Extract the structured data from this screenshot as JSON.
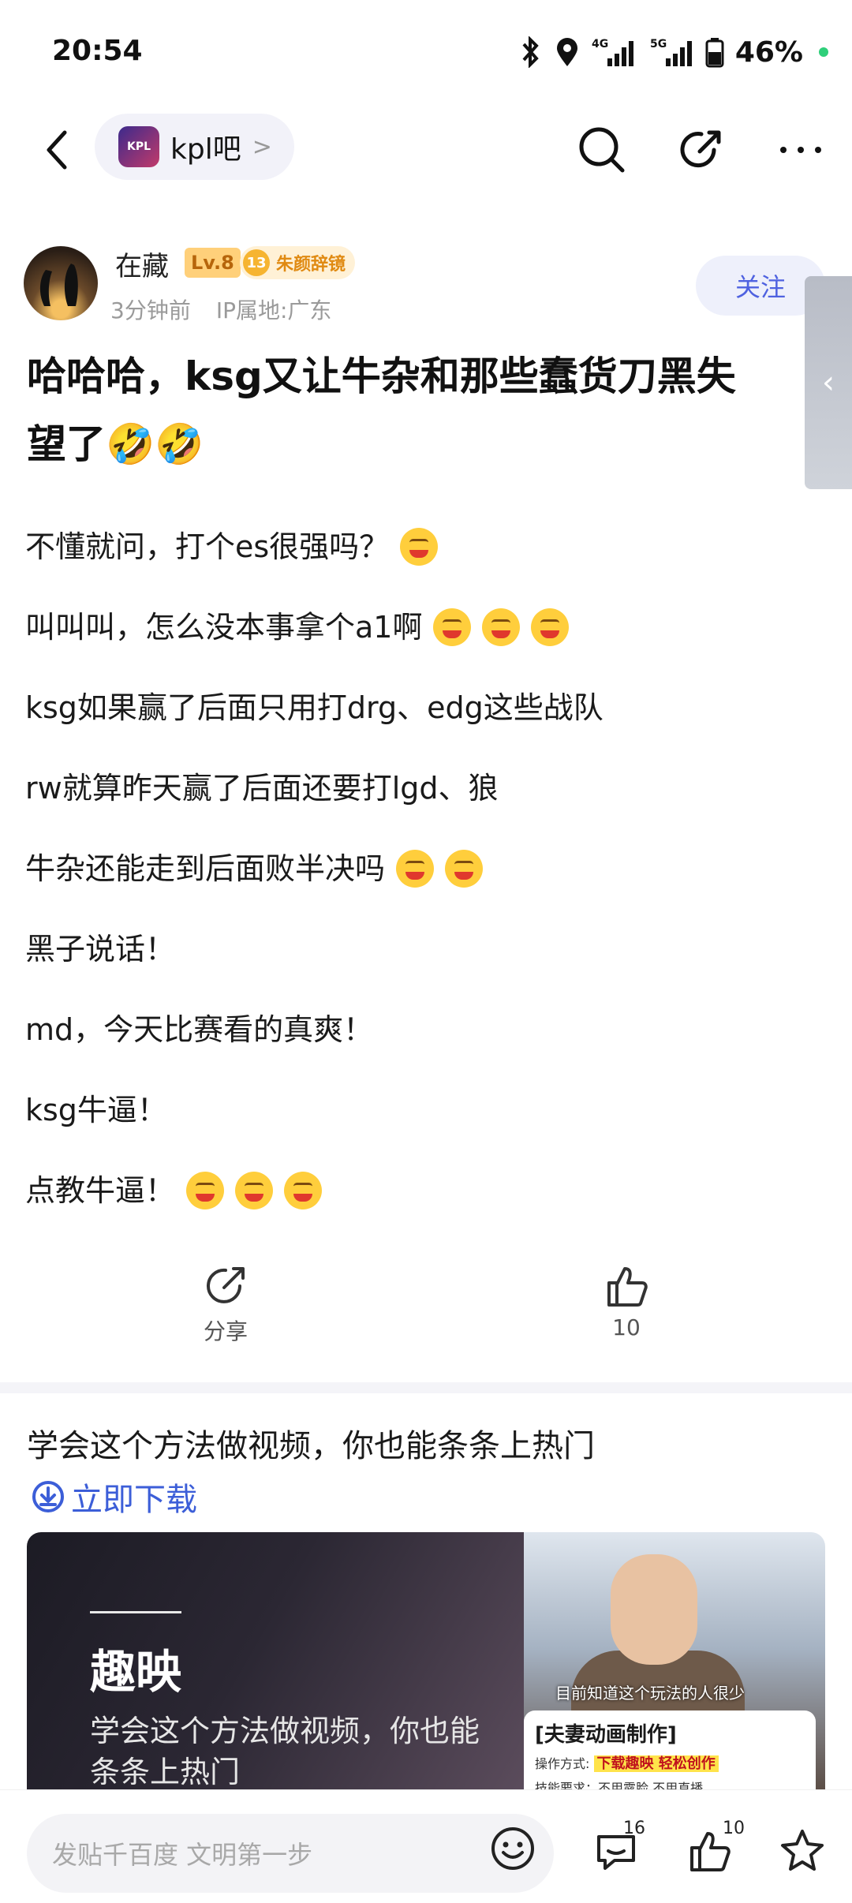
{
  "status_bar": {
    "time": "20:54",
    "network_left": "4G",
    "network_right": "5G",
    "battery": "46%",
    "icons": [
      "bluetooth-icon",
      "location-icon",
      "signal-4g-icon",
      "signal-5g-icon",
      "battery-icon"
    ]
  },
  "nav": {
    "forum_logo_text": "KPL",
    "forum_name": "kpl吧",
    "forum_arrow": ">",
    "icons": [
      "back-icon",
      "search-icon",
      "share-edit-icon",
      "more-icon"
    ]
  },
  "author": {
    "name": "在藏",
    "level": "Lv.8",
    "honor_level": "13",
    "honor_title": "朱颜辞镜",
    "time_ago": "3分钟前",
    "ip_location": "IP属地:广东",
    "follow_label": "关注"
  },
  "side_tab": {
    "arrow": "‹"
  },
  "post": {
    "title_line1": "哈哈哈，ksg又让牛杂和那些蠢货刀黑失",
    "title_line2": "望了🤣🤣",
    "paragraphs": [
      {
        "text": "不懂就问，打个es很强吗？",
        "emoji_count": 1
      },
      {
        "text": "叫叫叫，怎么没本事拿个a1啊",
        "emoji_count": 3
      },
      {
        "text": "ksg如果赢了后面只用打drg、edg这些战队",
        "emoji_count": 0
      },
      {
        "text": "rw就算昨天赢了后面还要打lgd、狼",
        "emoji_count": 0
      },
      {
        "text": "牛杂还能走到后面败半决吗",
        "emoji_count": 2
      },
      {
        "text": "黑子说话！",
        "emoji_count": 0
      },
      {
        "text": "md，今天比赛看的真爽！",
        "emoji_count": 0
      },
      {
        "text": "ksg牛逼！",
        "emoji_count": 0
      },
      {
        "text": "点教牛逼！",
        "emoji_count": 3
      }
    ]
  },
  "actions": {
    "share_label": "分享",
    "like_count": "10"
  },
  "ad": {
    "title": "学会这个方法做视频，你也能条条上热门",
    "download_label": "立即下载",
    "brand": "趣映",
    "desc": "学会这个方法做视频，你也能条条上热门",
    "caption": "目前知道这个玩法的人很少",
    "box_title": "[夫妻动画制作]",
    "box_row1_label": "操作方式:",
    "box_row1_highlight": "下载趣映 轻松创作",
    "box_row2": "技能要求：不用露脸 不用直播"
  },
  "bottom_bar": {
    "input_placeholder": "发贴千百度 文明第一步",
    "comment_count": "16",
    "like_count": "10"
  }
}
